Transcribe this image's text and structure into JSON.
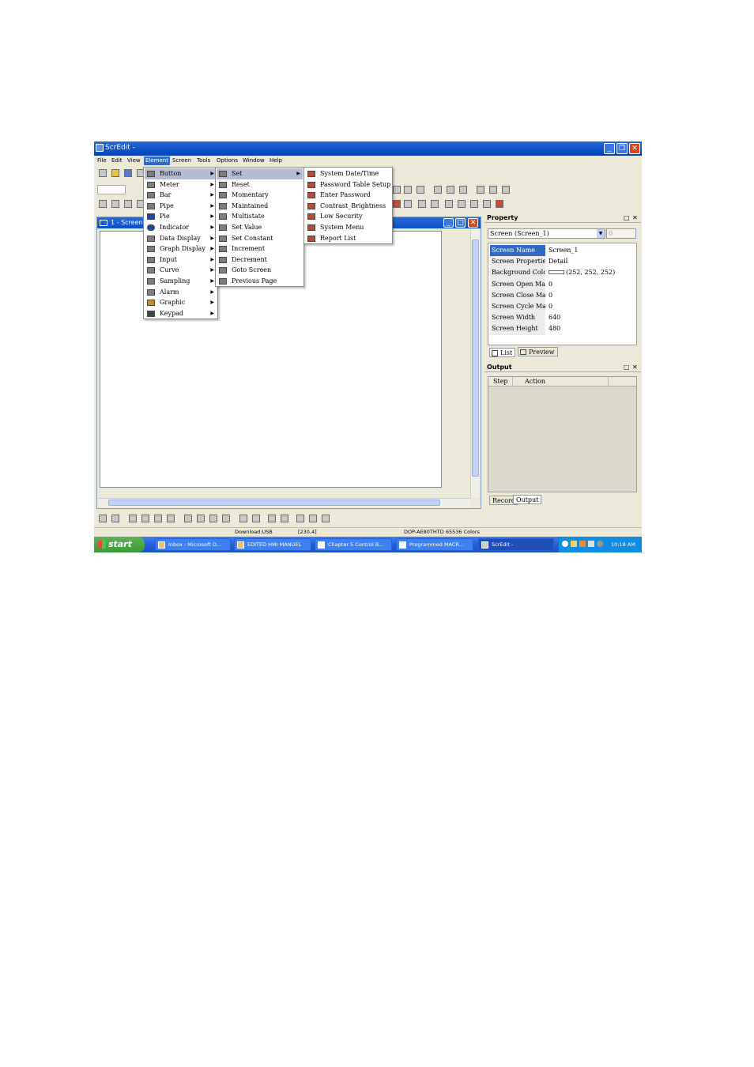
{
  "window": {
    "title": "ScrEdit -"
  },
  "menubar": [
    "File",
    "Edit",
    "View",
    "Element",
    "Screen",
    "Tools",
    "Options",
    "Window",
    "Help"
  ],
  "active_menu": "Element",
  "child": {
    "title": "1 - Screen"
  },
  "element_menu": [
    {
      "label": "Button",
      "icon": "button-icon",
      "submenu": true,
      "selected": true
    },
    {
      "label": "Meter",
      "icon": "meter-icon",
      "submenu": true
    },
    {
      "label": "Bar",
      "icon": "bar-icon",
      "submenu": true
    },
    {
      "label": "Pipe",
      "icon": "pipe-icon",
      "submenu": true
    },
    {
      "label": "Pie",
      "icon": "pie-icon",
      "submenu": true
    },
    {
      "label": "Indicator",
      "icon": "indicator-icon",
      "submenu": true
    },
    {
      "label": "Data Display",
      "icon": "data-display-icon",
      "submenu": true
    },
    {
      "label": "Graph Display",
      "icon": "graph-display-icon",
      "submenu": true
    },
    {
      "label": "Input",
      "icon": "input-icon",
      "submenu": true
    },
    {
      "label": "Curve",
      "icon": "curve-icon",
      "submenu": true
    },
    {
      "label": "Sampling",
      "icon": "sampling-icon",
      "submenu": true
    },
    {
      "label": "Alarm",
      "icon": "alarm-icon",
      "submenu": true
    },
    {
      "label": "Graphic",
      "icon": "graphic-icon",
      "submenu": true
    },
    {
      "label": "Keypad",
      "icon": "keypad-icon",
      "submenu": true
    }
  ],
  "button_menu": [
    {
      "label": "Set",
      "selected": true
    },
    {
      "label": "Reset"
    },
    {
      "label": "Momentary"
    },
    {
      "label": "Maintained"
    },
    {
      "label": "Multistate"
    },
    {
      "label": "Set Value"
    },
    {
      "label": "Set Constant"
    },
    {
      "label": "Increment"
    },
    {
      "label": "Decrement"
    },
    {
      "label": "Goto Screen"
    },
    {
      "label": "Previous Page"
    }
  ],
  "set_menu": [
    "System Date/Time",
    "Password Table Setup",
    "Enter Password",
    "Contrast_Brightness",
    "Low Security",
    "System Menu",
    "Report List"
  ],
  "property": {
    "header": "Property",
    "combo_value": "Screen (Screen_1)",
    "spin_value": "0",
    "rows": [
      {
        "key": "Screen Name",
        "value": "Screen_1"
      },
      {
        "key": "Screen Properties",
        "value": "Detail"
      },
      {
        "key": "Background Color",
        "value": "(252, 252, 252)"
      },
      {
        "key": "Screen Open Macro",
        "value": "0"
      },
      {
        "key": "Screen Close Macro",
        "value": "0"
      },
      {
        "key": "Screen Cycle Macro",
        "value": "0"
      },
      {
        "key": "Screen Width",
        "value": "640"
      },
      {
        "key": "Screen Height",
        "value": "480"
      }
    ],
    "tabs": [
      "List",
      "Preview"
    ]
  },
  "output": {
    "header": "Output",
    "columns": [
      "Step",
      "Action"
    ],
    "tabs": [
      "Record",
      "Output"
    ]
  },
  "status": {
    "download": "Download:USB",
    "coords": "[230,4]",
    "model": "DOP-AE80THTD 65536 Colors"
  },
  "taskbar": {
    "start": "start",
    "tasks": [
      {
        "label": "Inbox - Microsoft O..."
      },
      {
        "label": "EDITED HMI MANUEL"
      },
      {
        "label": "Chapter 5 Control B..."
      },
      {
        "label": "Programmed MACR..."
      },
      {
        "label": "ScrEdit -"
      }
    ],
    "clock": "10:18 AM"
  }
}
